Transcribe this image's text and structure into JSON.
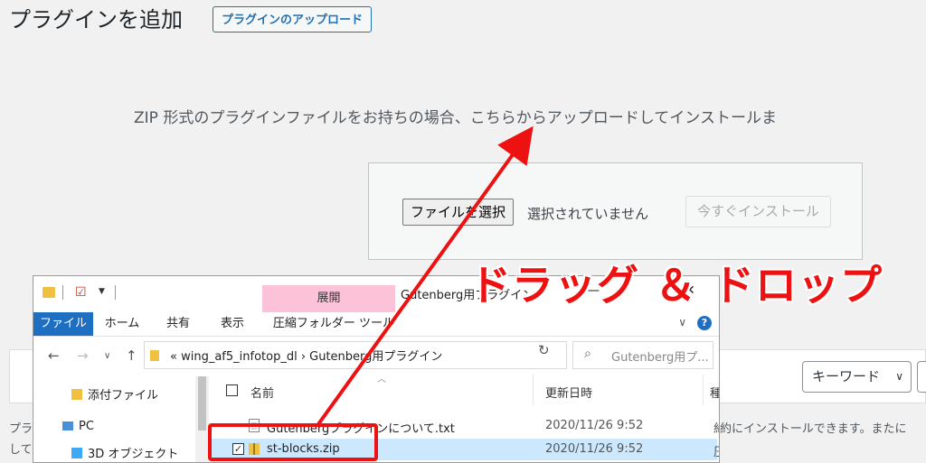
{
  "wp": {
    "title": "プラグインを追加",
    "upload_button": "プラグインのアップロード",
    "description": "ZIP 形式のプラグインファイルをお持ちの場合、こちらからアップロードしてインストールま",
    "choose_file": "ファイルを選択",
    "no_file": "選択されていません",
    "install_now": "今すぐインストール",
    "keyword_select": "キーワード",
    "bottom_right": "約にインストールできます。またに",
    "bottom_left_1": "プラ",
    "bottom_left_2": "して"
  },
  "explorer": {
    "context_tab": "展開",
    "window_title": "Gutenberg用プラグイン",
    "ribbon_tabs": [
      "ファイル",
      "ホーム",
      "共有",
      "表示",
      "圧縮フォルダー ツール"
    ],
    "address": "«  wing_af5_infotop_dl  ›  Gutenberg用プラグイン",
    "search_placeholder": "Gutenberg用プ...",
    "nav_items": [
      "添付ファイル",
      "PC",
      "3D オブジェクト"
    ],
    "columns": {
      "name": "名前",
      "date": "更新日時",
      "extra": "種"
    },
    "files": [
      {
        "name": "Gutenbergプラグインについて.txt",
        "date": "2020/11/26 9:52",
        "icon": "text-file-icon",
        "selected": false
      },
      {
        "name": "st-blocks.zip",
        "date": "2020/11/26 9:52",
        "icon": "zip-folder-icon",
        "selected": true
      }
    ],
    "side_marks": [
      "約",
      "圧"
    ]
  },
  "annotation": {
    "label": "ドラッグ ＆ ドロップ",
    "color": "#ee1111"
  }
}
